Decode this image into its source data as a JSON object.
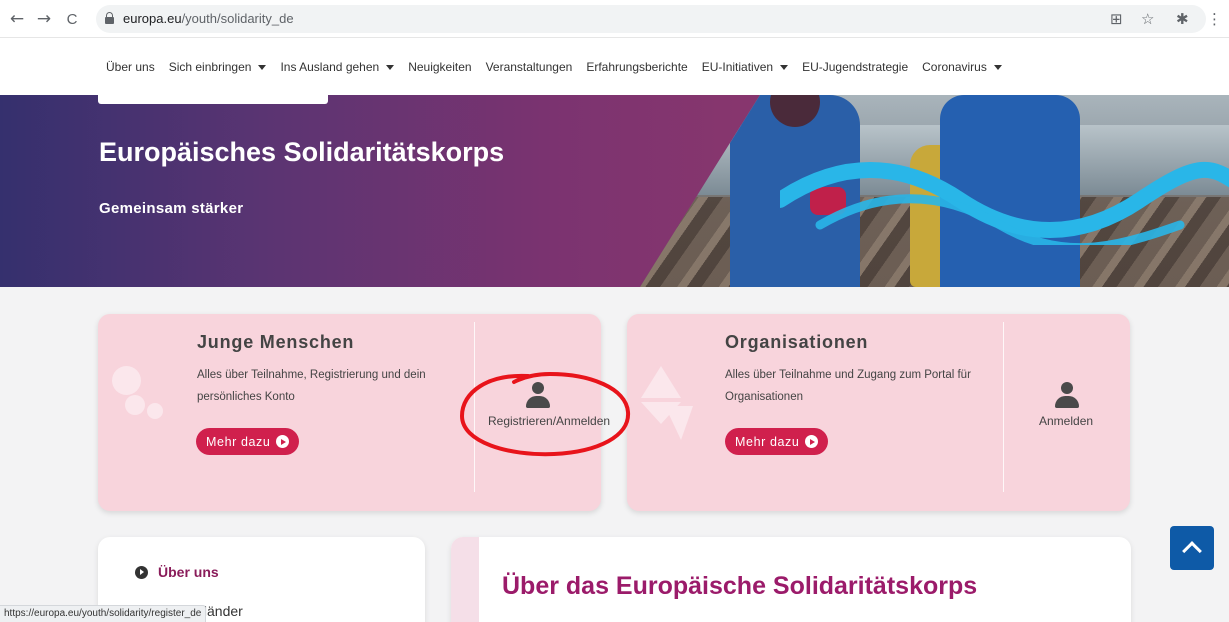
{
  "browser": {
    "url_domain": "europa.eu",
    "url_path": "/youth/solidarity_de",
    "back_icon": "←",
    "forward_icon": "→",
    "reload_icon": "C",
    "translate_icon": "⊞",
    "star_icon": "☆",
    "extensions_icon": "✱",
    "menu_icon": "⋮"
  },
  "nav": {
    "items": [
      {
        "label": "Über uns",
        "dropdown": false
      },
      {
        "label": "Sich einbringen",
        "dropdown": true
      },
      {
        "label": "Ins Ausland gehen",
        "dropdown": true
      },
      {
        "label": "Neuigkeiten",
        "dropdown": false
      },
      {
        "label": "Veranstaltungen",
        "dropdown": false
      },
      {
        "label": "Erfahrungsberichte",
        "dropdown": false
      },
      {
        "label": "EU-Initiativen",
        "dropdown": true
      },
      {
        "label": "EU-Jugendstrategie",
        "dropdown": false
      },
      {
        "label": "Coronavirus",
        "dropdown": true
      }
    ]
  },
  "hero": {
    "title": "Europäisches Solidaritätskorps",
    "subtitle": "Gemeinsam stärker"
  },
  "cards": {
    "young": {
      "title": "Junge Menschen",
      "text": "Alles über Teilnahme, Registrierung und dein persönliches Konto",
      "button": "Mehr dazu",
      "action_label": "Registrieren/Anmelden"
    },
    "orgs": {
      "title": "Organisationen",
      "text": "Alles über Teilnahme und Zugang zum Portal für Organisationen",
      "button": "Mehr dazu",
      "action_label": "Anmelden"
    }
  },
  "sidebar": {
    "link1": "Über uns",
    "link2": "Partnerländer"
  },
  "main": {
    "heading": "Über das Europäische Solidaritätskorps"
  },
  "status_url": "https://europa.eu/youth/solidarity/register_de",
  "colors": {
    "accent": "#d0204d",
    "heading": "#9b1b6a",
    "card_bg": "#f8d4dc",
    "to_top": "#0e5aa7",
    "annotation": "#e8141b"
  }
}
